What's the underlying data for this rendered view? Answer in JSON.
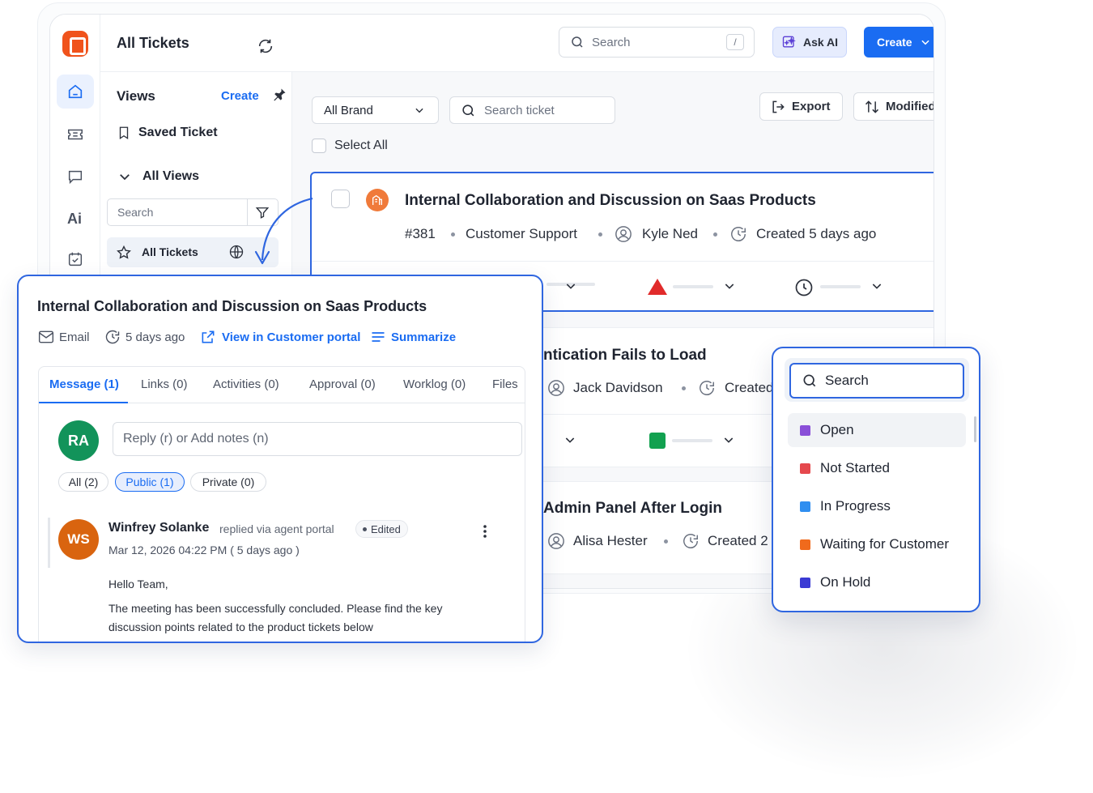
{
  "header": {
    "title": "All Tickets",
    "search_placeholder": "Search",
    "search_shortcut": "/",
    "ask_ai_label": "Ask AI",
    "create_label": "Create"
  },
  "views": {
    "title": "Views",
    "create_label": "Create",
    "saved_ticket_label": "Saved Ticket",
    "all_views_label": "All Views",
    "search_placeholder": "Search",
    "all_tickets_label": "All Tickets"
  },
  "toolbar": {
    "brand_select": "All Brand",
    "search_ticket_placeholder": "Search ticket",
    "export_label": "Export",
    "modified_label": "Modified",
    "select_all_label": "Select All"
  },
  "tickets": [
    {
      "title": "Internal Collaboration and Discussion on Saas Products",
      "id": "#381",
      "group": "Customer Support",
      "agent": "Kyle Ned",
      "created": "Created 5 days ago"
    },
    {
      "title": "ntication Fails to Load",
      "agent": "Jack Davidson",
      "created": "Created"
    },
    {
      "title": "Admin Panel After Login",
      "agent": "Alisa Hester",
      "created": "Created 2"
    }
  ],
  "detail": {
    "title": "Internal Collaboration and Discussion on Saas Products",
    "channel": "Email",
    "age": "5 days ago",
    "portal_link": "View in Customer portal",
    "summarize_label": "Summarize",
    "tabs": [
      "Message (1)",
      "Links (0)",
      "Activities (0)",
      "Approval (0)",
      "Worklog (0)",
      "Files"
    ],
    "user_initials": "RA",
    "reply_placeholder": "Reply (r) or Add notes (n)",
    "filters": [
      "All (2)",
      "Public (1)",
      "Private (0)"
    ],
    "message": {
      "initials": "WS",
      "author": "Winfrey Solanke",
      "via": "replied via agent portal",
      "edited": "Edited",
      "timestamp": "Mar 12, 2026 04:22 PM ( 5 days ago )",
      "greeting": "Hello Team,",
      "body_line1": "The meeting has been successfully concluded. Please find the key",
      "body_line2": "discussion points related to the product tickets below"
    }
  },
  "status_dropdown": {
    "search_placeholder": "Search",
    "options": [
      {
        "label": "Open",
        "color": "#8a4fd8"
      },
      {
        "label": "Not Started",
        "color": "#e5484d"
      },
      {
        "label": "In Progress",
        "color": "#2f8ef0"
      },
      {
        "label": "Waiting for Customer",
        "color": "#f06a1c"
      },
      {
        "label": "On Hold",
        "color": "#3b3bd4"
      }
    ]
  },
  "colors": {
    "accent": "#1a6cf2",
    "brand": "#f0531c",
    "priority_high": "#e12b2b",
    "status_green": "#12a150"
  }
}
